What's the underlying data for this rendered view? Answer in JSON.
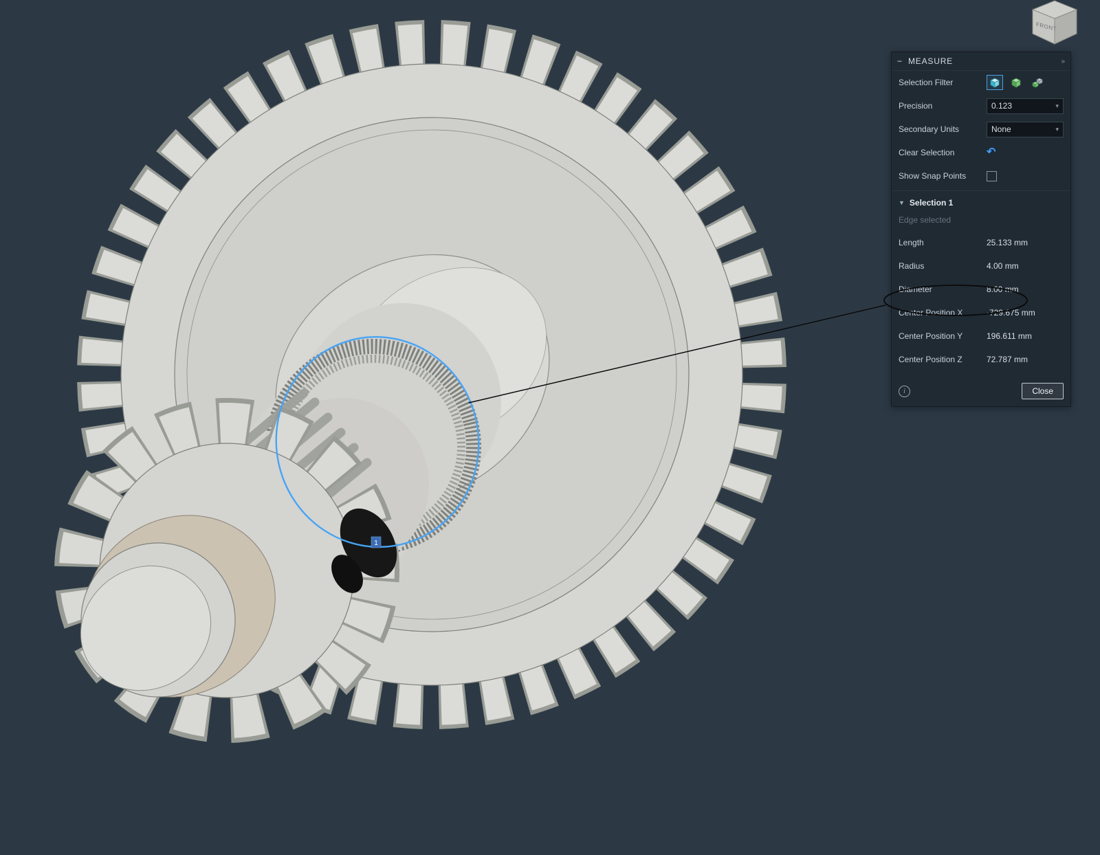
{
  "view_cube": {
    "front_label": "FRONT"
  },
  "viewport": {
    "selection_badge": "1"
  },
  "icons": {
    "collapse": "−",
    "dock": "»",
    "caret": "▾",
    "undo": "↶",
    "info": "i",
    "selection_triangle": "▼"
  },
  "measure_panel": {
    "title": "MEASURE",
    "selection_filter_label": "Selection Filter",
    "precision_label": "Precision",
    "precision_value": "0.123",
    "secondary_units_label": "Secondary Units",
    "secondary_units_value": "None",
    "clear_selection_label": "Clear Selection",
    "show_snap_points_label": "Show Snap Points",
    "selection_title": "Selection 1",
    "selection_subtitle": "Edge selected",
    "measurements": [
      {
        "label": "Length",
        "value": "25.133 mm"
      },
      {
        "label": "Radius",
        "value": "4.00 mm"
      },
      {
        "label": "Diameter",
        "value": "8.00 mm"
      },
      {
        "label": "Center Position X",
        "value": "-729.675 mm"
      },
      {
        "label": "Center Position Y",
        "value": "196.611 mm"
      },
      {
        "label": "Center Position Z",
        "value": "72.787 mm"
      }
    ],
    "close_label": "Close"
  },
  "colors": {
    "accent_blue": "#3f9bf5",
    "selection_highlight": "#47a4f5",
    "annotation": "#0a0a0a",
    "panel_bg": "#202a33",
    "viewport_bg": "#2c3945"
  }
}
